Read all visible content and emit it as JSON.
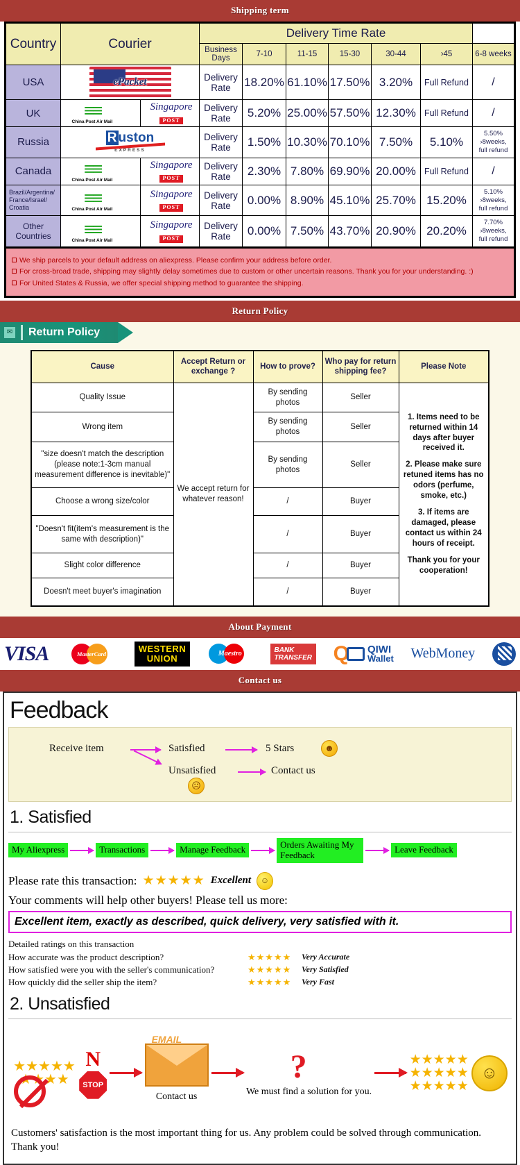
{
  "banners": {
    "shipping": "Shipping term",
    "return": "Return Policy",
    "payment": "About Payment",
    "contact": "Contact us"
  },
  "shipping": {
    "headers": {
      "country": "Country",
      "courier": "Courier",
      "delivery_time_rate": "Delivery Time Rate",
      "business_days": "Business Days",
      "cols": [
        "7-10",
        "11-15",
        "15-30",
        "30-44",
        "›45",
        "6-8 weeks"
      ]
    },
    "rate_label": "Delivery Rate",
    "rows": [
      {
        "country": "USA",
        "couriers": [
          "epacket"
        ],
        "values": [
          "18.20%",
          "61.10%",
          "17.50%",
          "3.20%",
          "Full Refund",
          "/"
        ]
      },
      {
        "country": "UK",
        "couriers": [
          "china-post-air-mail",
          "singapore-post"
        ],
        "values": [
          "5.20%",
          "25.00%",
          "57.50%",
          "12.30%",
          "Full Refund",
          "/"
        ]
      },
      {
        "country": "Russia",
        "couriers": [
          "ruston-express"
        ],
        "values": [
          "1.50%",
          "10.30%",
          "70.10%",
          "7.50%",
          "5.10%",
          "5.50%\n›8weeks,\nfull refund"
        ]
      },
      {
        "country": "Canada",
        "couriers": [
          "china-post-air-mail",
          "singapore-post"
        ],
        "values": [
          "2.30%",
          "7.80%",
          "69.90%",
          "20.00%",
          "Full Refund",
          "/"
        ]
      },
      {
        "country": "Brazil/Argentina/\nFrance/Israel/\nCroatia",
        "couriers": [
          "china-post-air-mail",
          "singapore-post"
        ],
        "values": [
          "0.00%",
          "8.90%",
          "45.10%",
          "25.70%",
          "15.20%",
          "5.10%\n›8weeks,\nfull refund"
        ]
      },
      {
        "country": "Other Countries",
        "couriers": [
          "china-post-air-mail",
          "singapore-post"
        ],
        "values": [
          "0.00%",
          "7.50%",
          "43.70%",
          "20.90%",
          "20.20%",
          "7.70%\n›8weeks,\nfull refund"
        ]
      }
    ],
    "notes": [
      "We ship parcels to your default address on aliexpress. Please confirm your address before order.",
      "For cross-broad trade, shipping may slightly delay sometimes due to custom or other uncertain reasons. Thank you for your understanding. :)",
      "For United States & Russia, we offer special shipping method to guarantee the shipping."
    ]
  },
  "return_policy": {
    "tag_label": "Return Policy",
    "headers": [
      "Cause",
      "Accept Return or exchange ?",
      "How to prove?",
      "Who pay for return shipping fee?",
      "Please Note"
    ],
    "accept_text": "We accept return for whatever reason!",
    "rows": [
      {
        "cause": "Quality Issue",
        "prove": "By sending photos",
        "who_pays": "Seller"
      },
      {
        "cause": "Wrong item",
        "prove": "By sending photos",
        "who_pays": "Seller"
      },
      {
        "cause": "\"size doesn't match the description (please note:1-3cm manual measurement difference is inevitable)\"",
        "prove": "By sending photos",
        "who_pays": "Seller"
      },
      {
        "cause": "Choose a wrong size/color",
        "prove": "/",
        "who_pays": "Buyer"
      },
      {
        "cause": "\"Doesn't fit(item's measurement is the same with description)\"",
        "prove": "/",
        "who_pays": "Buyer"
      },
      {
        "cause": "Slight color difference",
        "prove": "/",
        "who_pays": "Buyer"
      },
      {
        "cause": "Doesn't meet buyer's imagination",
        "prove": "/",
        "who_pays": "Buyer"
      }
    ],
    "notes": [
      "1. Items need to be returned within 14 days after buyer received it.",
      "2. Please make sure retuned items has no odors (perfume, smoke, etc.)",
      "3. If items are damaged, please contact us within 24 hours of receipt.",
      "Thank you for your cooperation!"
    ]
  },
  "payment": {
    "methods": [
      {
        "name": "visa",
        "label": "VISA"
      },
      {
        "name": "mastercard",
        "label": "MasterCard"
      },
      {
        "name": "western-union",
        "label_line1": "WESTERN",
        "label_line2": "UNION"
      },
      {
        "name": "maestro",
        "label": "Maestro"
      },
      {
        "name": "bank-transfer",
        "label_line1": "BANK",
        "label_line2": "TRANSFER"
      },
      {
        "name": "qiwi-wallet",
        "label_line1": "QIWI",
        "label_line2": "Wallet"
      },
      {
        "name": "webmoney",
        "label": "WebMoney"
      }
    ]
  },
  "feedback": {
    "title": "Feedback",
    "flow": {
      "receive": "Receive item",
      "satisfied": "Satisfied",
      "stars5": "5 Stars",
      "unsatisfied": "Unsatisfied",
      "contact": "Contact us"
    },
    "satisfied": {
      "heading": "1. Satisfied",
      "steps": [
        "My Aliexpress",
        "Transactions",
        "Manage Feedback",
        "Orders Awaiting My Feedback",
        "Leave Feedback"
      ],
      "rate_prompt": "Please rate this transaction:",
      "stars": "★★★★★",
      "rating_word": "Excellent",
      "comment_prompt": "Your comments will help other buyers! Please tell us more:",
      "comment_text": "Excellent item, exactly as described, quick delivery, very satisfied with it.",
      "detailed_heading": "Detailed ratings on this transaction",
      "detailed": [
        {
          "question": "How accurate was the product description?",
          "stars": "★★★★★",
          "value": "Very Accurate"
        },
        {
          "question": "How satisfied were you with the seller's communication?",
          "stars": "★★★★★",
          "value": "Very Satisfied"
        },
        {
          "question": "How quickly did the seller ship the item?",
          "stars": "★★★★★",
          "value": "Very Fast"
        }
      ]
    },
    "unsatisfied": {
      "heading": "2. Unsatisfied",
      "no_label": "N",
      "stop_label": "STOP",
      "email_label": "EMAIL",
      "contact_caption": "Contact us",
      "solution_caption": "We must find a solution for you.",
      "closing": "Customers' satisfaction is the most important thing for us. Any problem could be solved through communication. Thank you!"
    }
  }
}
